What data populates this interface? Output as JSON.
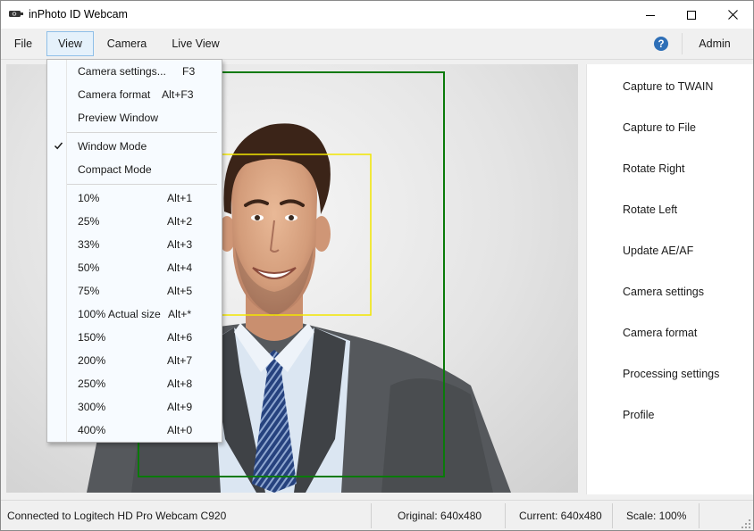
{
  "window": {
    "title": "inPhoto ID Webcam",
    "icons": {
      "app": "webcam-icon",
      "minimize": "minimize-icon",
      "maximize": "maximize-icon",
      "close": "close-icon"
    }
  },
  "menubar": {
    "items": [
      "File",
      "View",
      "Camera",
      "Live View"
    ],
    "active": "View",
    "help_icon": "help-icon",
    "admin_label": "Admin"
  },
  "view_menu": {
    "sections": [
      [
        {
          "label": "Camera settings...",
          "shortcut": "F3"
        },
        {
          "label": "Camera format",
          "shortcut": "Alt+F3"
        },
        {
          "label": "Preview Window",
          "shortcut": ""
        }
      ],
      [
        {
          "label": "Window Mode",
          "shortcut": "",
          "checked": true
        },
        {
          "label": "Compact Mode",
          "shortcut": ""
        }
      ],
      [
        {
          "label": "10%",
          "shortcut": "Alt+1"
        },
        {
          "label": "25%",
          "shortcut": "Alt+2"
        },
        {
          "label": "33%",
          "shortcut": "Alt+3"
        },
        {
          "label": "50%",
          "shortcut": "Alt+4"
        },
        {
          "label": "75%",
          "shortcut": "Alt+5"
        },
        {
          "label": "100% Actual size",
          "shortcut": "Alt+*"
        },
        {
          "label": "150%",
          "shortcut": "Alt+6"
        },
        {
          "label": "200%",
          "shortcut": "Alt+7"
        },
        {
          "label": "250%",
          "shortcut": "Alt+8"
        },
        {
          "label": "300%",
          "shortcut": "Alt+9"
        },
        {
          "label": "400%",
          "shortcut": "Alt+0"
        }
      ]
    ],
    "check_icon": "checkmark-icon"
  },
  "side_panel": {
    "buttons": [
      "Capture to TWAIN",
      "Capture to File",
      "Rotate Right",
      "Rotate Left",
      "Update AE/AF",
      "Camera settings",
      "Camera format",
      "Processing settings",
      "Profile"
    ]
  },
  "preview": {
    "overlay_colors": {
      "frame": "#0a7a0a",
      "face_box": "#f2e600"
    }
  },
  "statusbar": {
    "connection": "Connected to Logitech HD Pro Webcam C920",
    "original": "Original: 640x480",
    "current": "Current: 640x480",
    "scale": "Scale: 100%",
    "grip_icon": "resize-grip-icon"
  }
}
